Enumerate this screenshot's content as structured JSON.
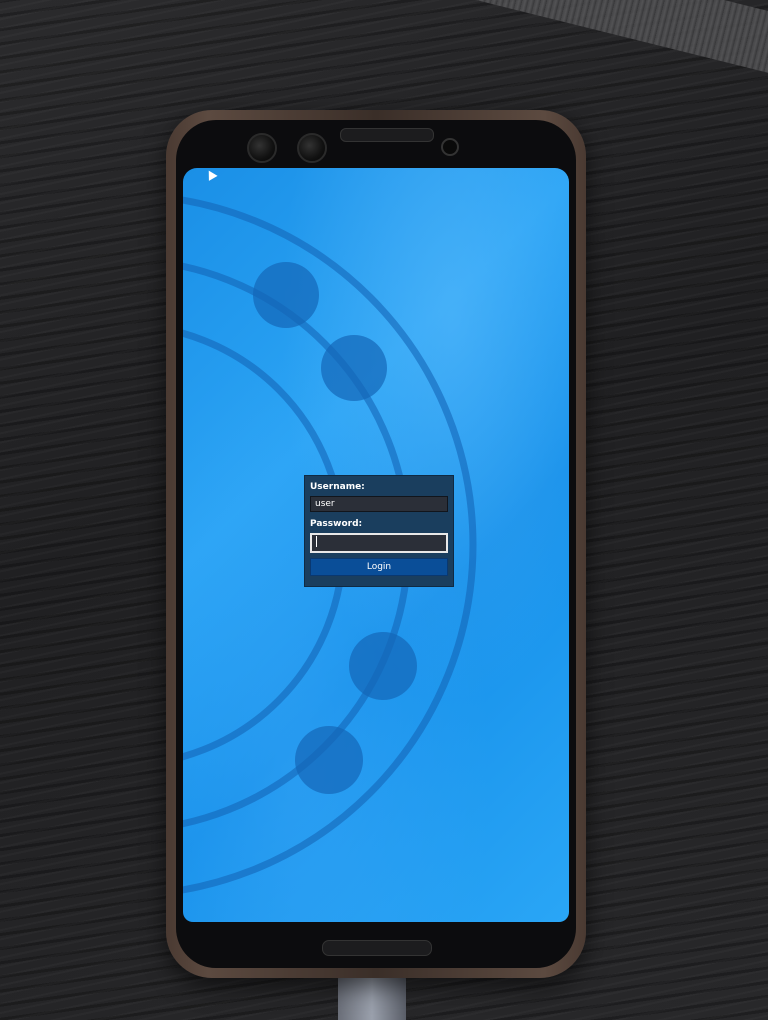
{
  "login": {
    "username_label": "Username:",
    "username_value": "user",
    "password_label": "Password:",
    "password_value": "",
    "button_label": "Login"
  },
  "colors": {
    "wallpaper_blue": "#1a8fe6",
    "dialog_bg": "#1a3e5e",
    "button_bg": "#0a4e98"
  }
}
